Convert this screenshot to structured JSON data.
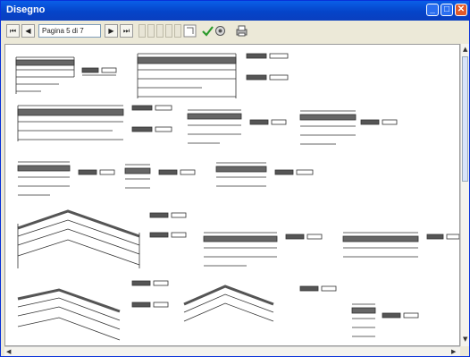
{
  "window": {
    "title": "Disegno"
  },
  "toolbar": {
    "page_field_value": "Pagina 5 di 7",
    "nav_first": "⏮",
    "nav_prev": "◀",
    "nav_next": "▶",
    "nav_last": "⏭",
    "zoom_icon": "zoom-icon",
    "check_icon": "check-icon",
    "settings_icon": "settings-icon",
    "print_icon": "print-icon"
  },
  "colors": {
    "titlebar": "#0A5FE8",
    "window_bg": "#ECE9D8",
    "drawing_ink": "#333333"
  }
}
